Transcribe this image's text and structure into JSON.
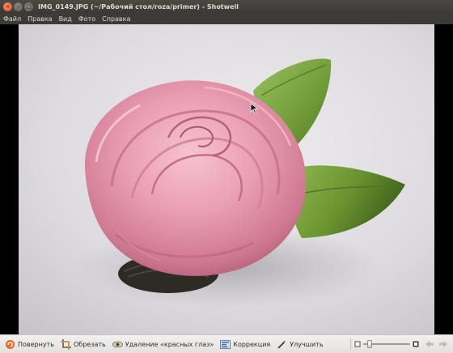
{
  "window": {
    "title": "IMG_0149.JPG (~/Рабочий стол/roza/primer) - Shotwell",
    "close_glyph": "×",
    "minimize_glyph": "–",
    "maximize_glyph": "□"
  },
  "menu": {
    "items": [
      "Файл",
      "Правка",
      "Вид",
      "Фото",
      "Справка"
    ]
  },
  "photo": {
    "subject": "pink satin ribbon rose with green leaves"
  },
  "toolbar": {
    "rotate_label": "Повернуть",
    "crop_label": "Обрезать",
    "redeye_label": "Удаление «красных глаз»",
    "adjust_label": "Коррекция",
    "enhance_label": "Улучшить"
  },
  "zoom": {
    "level": 0.1
  },
  "colors": {
    "accent_close": "#d9461b",
    "titlebar_bg": "#3c3b37",
    "toolbar_bg": "#efeeec"
  },
  "icons": {
    "rotate": "rotate-icon",
    "crop": "crop-icon",
    "redeye": "redeye-icon",
    "adjust": "adjust-icon",
    "enhance": "enhance-icon",
    "zoom_out": "zoom-out-icon",
    "zoom_in": "zoom-in-icon",
    "prev": "back-arrow-icon",
    "next": "forward-arrow-icon"
  }
}
